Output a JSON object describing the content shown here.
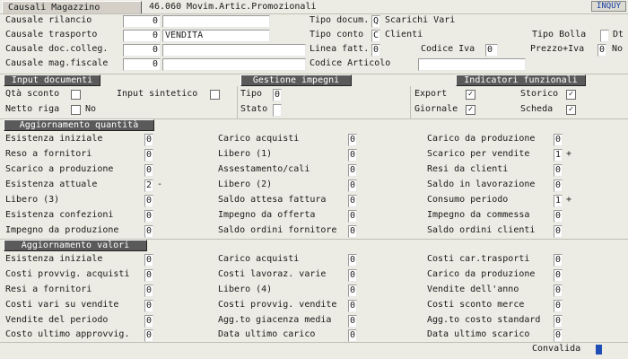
{
  "header": {
    "title_button": "Causali Magazzino",
    "code": "46.060",
    "description": "Movim.Artic.Promozionali",
    "inqu_badge": "INQUY"
  },
  "top_left": [
    {
      "label": "Causale rilancio",
      "value": "0",
      "text": ""
    },
    {
      "label": "Causale trasporto",
      "value": "0",
      "text": "VENDITA"
    },
    {
      "label": "Causale doc.colleg.",
      "value": "0",
      "text": ""
    },
    {
      "label": "Causale mag.fiscale",
      "value": "0",
      "text": ""
    }
  ],
  "top_right": {
    "tipo_docum_label": "Tipo docum.",
    "tipo_docum_code": "Q",
    "tipo_docum_text": "Scarichi Vari",
    "tipo_conto_label": "Tipo conto",
    "tipo_conto_code": "C",
    "tipo_conto_text": "Clienti",
    "tipo_bolla_label": "Tipo Bolla",
    "tipo_bolla_value": "",
    "dt_label": "Dt",
    "linea_fatt_label": "Linea fatt.",
    "linea_fatt_value": "0",
    "codice_iva_label": "Codice Iva",
    "codice_iva_value": "0",
    "prezzo_iva_label": "Prezzo+Iva",
    "prezzo_iva_value": "0",
    "no_label": "No",
    "codice_articolo_label": "Codice Articolo",
    "codice_articolo_value": ""
  },
  "sections": {
    "input_documenti": "Input documenti",
    "gestione_impegni": "Gestione impegni",
    "indicatori_funzionali": "Indicatori funzionali",
    "aggiornamento_quantita": "Aggiornamento quantità",
    "aggiornamento_valori": "Aggiornamento valori"
  },
  "input_documenti": {
    "qta_sconto_label": "Qtà sconto",
    "input_sintetico_label": "Input sintetico",
    "netto_riga_label": "Netto riga",
    "netto_riga_value": "No"
  },
  "gestione_impegni": {
    "tipo_label": "Tipo",
    "tipo_value": "0",
    "stato_label": "Stato",
    "stato_value": ""
  },
  "indicatori": {
    "export_label": "Export",
    "export_checked": "✓",
    "storico_label": "Storico",
    "storico_checked": "✓",
    "giornale_label": "Giornale",
    "giornale_checked": "✓",
    "scheda_label": "Scheda",
    "scheda_checked": "✓"
  },
  "quantita": {
    "col1": [
      {
        "label": "Esistenza iniziale",
        "value": "0",
        "sign": ""
      },
      {
        "label": "Reso    a fornitori",
        "value": "0",
        "sign": ""
      },
      {
        "label": "Scarico a produzione",
        "value": "0",
        "sign": ""
      },
      {
        "label": "Esistenza attuale",
        "value": "2",
        "sign": "-"
      },
      {
        "label": "Libero (3)",
        "value": "0",
        "sign": ""
      },
      {
        "label": "Esistenza confezioni",
        "value": "0",
        "sign": ""
      },
      {
        "label": "Impegno da produzione",
        "value": "0",
        "sign": ""
      }
    ],
    "col2": [
      {
        "label": "Carico acquisti",
        "value": "0",
        "sign": ""
      },
      {
        "label": "Libero (1)",
        "value": "0",
        "sign": ""
      },
      {
        "label": "Assestamento/cali",
        "value": "0",
        "sign": ""
      },
      {
        "label": "Libero (2)",
        "value": "0",
        "sign": ""
      },
      {
        "label": "Saldo attesa fattura",
        "value": "0",
        "sign": ""
      },
      {
        "label": "Impegno da offerta",
        "value": "0",
        "sign": ""
      },
      {
        "label": "Saldo ordini fornitore",
        "value": "0",
        "sign": ""
      }
    ],
    "col3": [
      {
        "label": "Carico da produzione",
        "value": "0",
        "sign": ""
      },
      {
        "label": "Scarico per vendite",
        "value": "1",
        "sign": "+"
      },
      {
        "label": "Resi  da clienti",
        "value": "0",
        "sign": ""
      },
      {
        "label": "Saldo in lavorazione",
        "value": "0",
        "sign": ""
      },
      {
        "label": "Consumo periodo",
        "value": "1",
        "sign": "+"
      },
      {
        "label": "Impegno da commessa",
        "value": "0",
        "sign": ""
      },
      {
        "label": "Saldo ordini clienti",
        "value": "0",
        "sign": ""
      }
    ]
  },
  "valori": {
    "col1": [
      {
        "label": "Esistenza iniziale",
        "value": "0"
      },
      {
        "label": "Costi provvig. acquisti",
        "value": "0"
      },
      {
        "label": "Resi a fornitori",
        "value": "0"
      },
      {
        "label": "Costi vari su vendite",
        "value": "0"
      },
      {
        "label": "Vendite del periodo",
        "value": "0"
      },
      {
        "label": "Costo ultimo approvvig.",
        "value": "0"
      }
    ],
    "col2": [
      {
        "label": "Carico acquisti",
        "value": "0"
      },
      {
        "label": "Costi lavoraz. varie",
        "value": "0"
      },
      {
        "label": "Libero (4)",
        "value": "0"
      },
      {
        "label": "Costi provvig. vendite",
        "value": "0"
      },
      {
        "label": "Agg.to giacenza media",
        "value": "0"
      },
      {
        "label": "Data ultimo carico",
        "value": "0"
      }
    ],
    "col3": [
      {
        "label": "Costi   car.trasporti",
        "value": "0"
      },
      {
        "label": "Carico da produzione",
        "value": "0"
      },
      {
        "label": "Vendite dell'anno",
        "value": "0"
      },
      {
        "label": "Costi sconto merce",
        "value": "0"
      },
      {
        "label": "Agg.to costo standard",
        "value": "0"
      },
      {
        "label": "Data ultimo scarico",
        "value": "0"
      }
    ]
  },
  "footer": {
    "convalida_label": "Convalida"
  },
  "colors": {
    "background": "#ecece4",
    "section_button": "#5a5a5a",
    "scroll_accent": "#1f4fb5",
    "inqu_text": "#1a3ea0"
  }
}
